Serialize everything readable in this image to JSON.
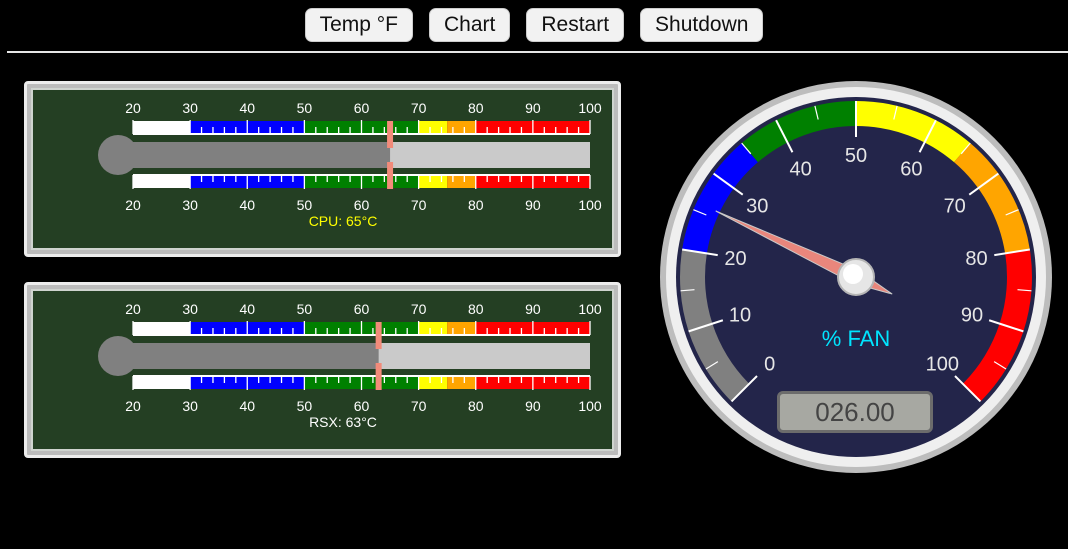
{
  "toolbar": {
    "buttons": [
      {
        "id": "temp",
        "label": "Temp °F"
      },
      {
        "id": "chart",
        "label": "Chart"
      },
      {
        "id": "restart",
        "label": "Restart"
      },
      {
        "id": "shutdown",
        "label": "Shutdown"
      }
    ]
  },
  "thermometers": [
    {
      "label": "CPU: 65°C",
      "value": 65,
      "label_color": "#ffff00",
      "scale_min": 20,
      "scale_max": 100,
      "ticks": [
        "20",
        "30",
        "40",
        "50",
        "60",
        "70",
        "80",
        "90",
        "100"
      ]
    },
    {
      "label": "RSX: 63°C",
      "value": 63,
      "label_color": "#ffffff",
      "scale_min": 20,
      "scale_max": 100,
      "ticks": [
        "20",
        "30",
        "40",
        "50",
        "60",
        "70",
        "80",
        "90",
        "100"
      ]
    }
  ],
  "thermo_bands": [
    {
      "from": 20,
      "to": 30,
      "color": "#ffffff"
    },
    {
      "from": 30,
      "to": 50,
      "color": "#0000ff"
    },
    {
      "from": 50,
      "to": 70,
      "color": "#008000"
    },
    {
      "from": 70,
      "to": 75,
      "color": "#ffff00"
    },
    {
      "from": 75,
      "to": 80,
      "color": "#ffa500"
    },
    {
      "from": 80,
      "to": 100,
      "color": "#ff0000"
    }
  ],
  "fan_gauge": {
    "title": "% FAN",
    "value": 26,
    "readout": "026.00",
    "min": 0,
    "max": 100,
    "ticks": [
      "0",
      "10",
      "20",
      "30",
      "40",
      "50",
      "60",
      "70",
      "80",
      "90",
      "100"
    ],
    "bands": [
      {
        "from": 0,
        "to": 20,
        "color": "#808080"
      },
      {
        "from": 20,
        "to": 35,
        "color": "#0000ff"
      },
      {
        "from": 35,
        "to": 50,
        "color": "#008000"
      },
      {
        "from": 50,
        "to": 65,
        "color": "#ffff00"
      },
      {
        "from": 65,
        "to": 80,
        "color": "#ffa500"
      },
      {
        "from": 80,
        "to": 100,
        "color": "#ff0000"
      }
    ],
    "title_color": "#00e5ff"
  }
}
